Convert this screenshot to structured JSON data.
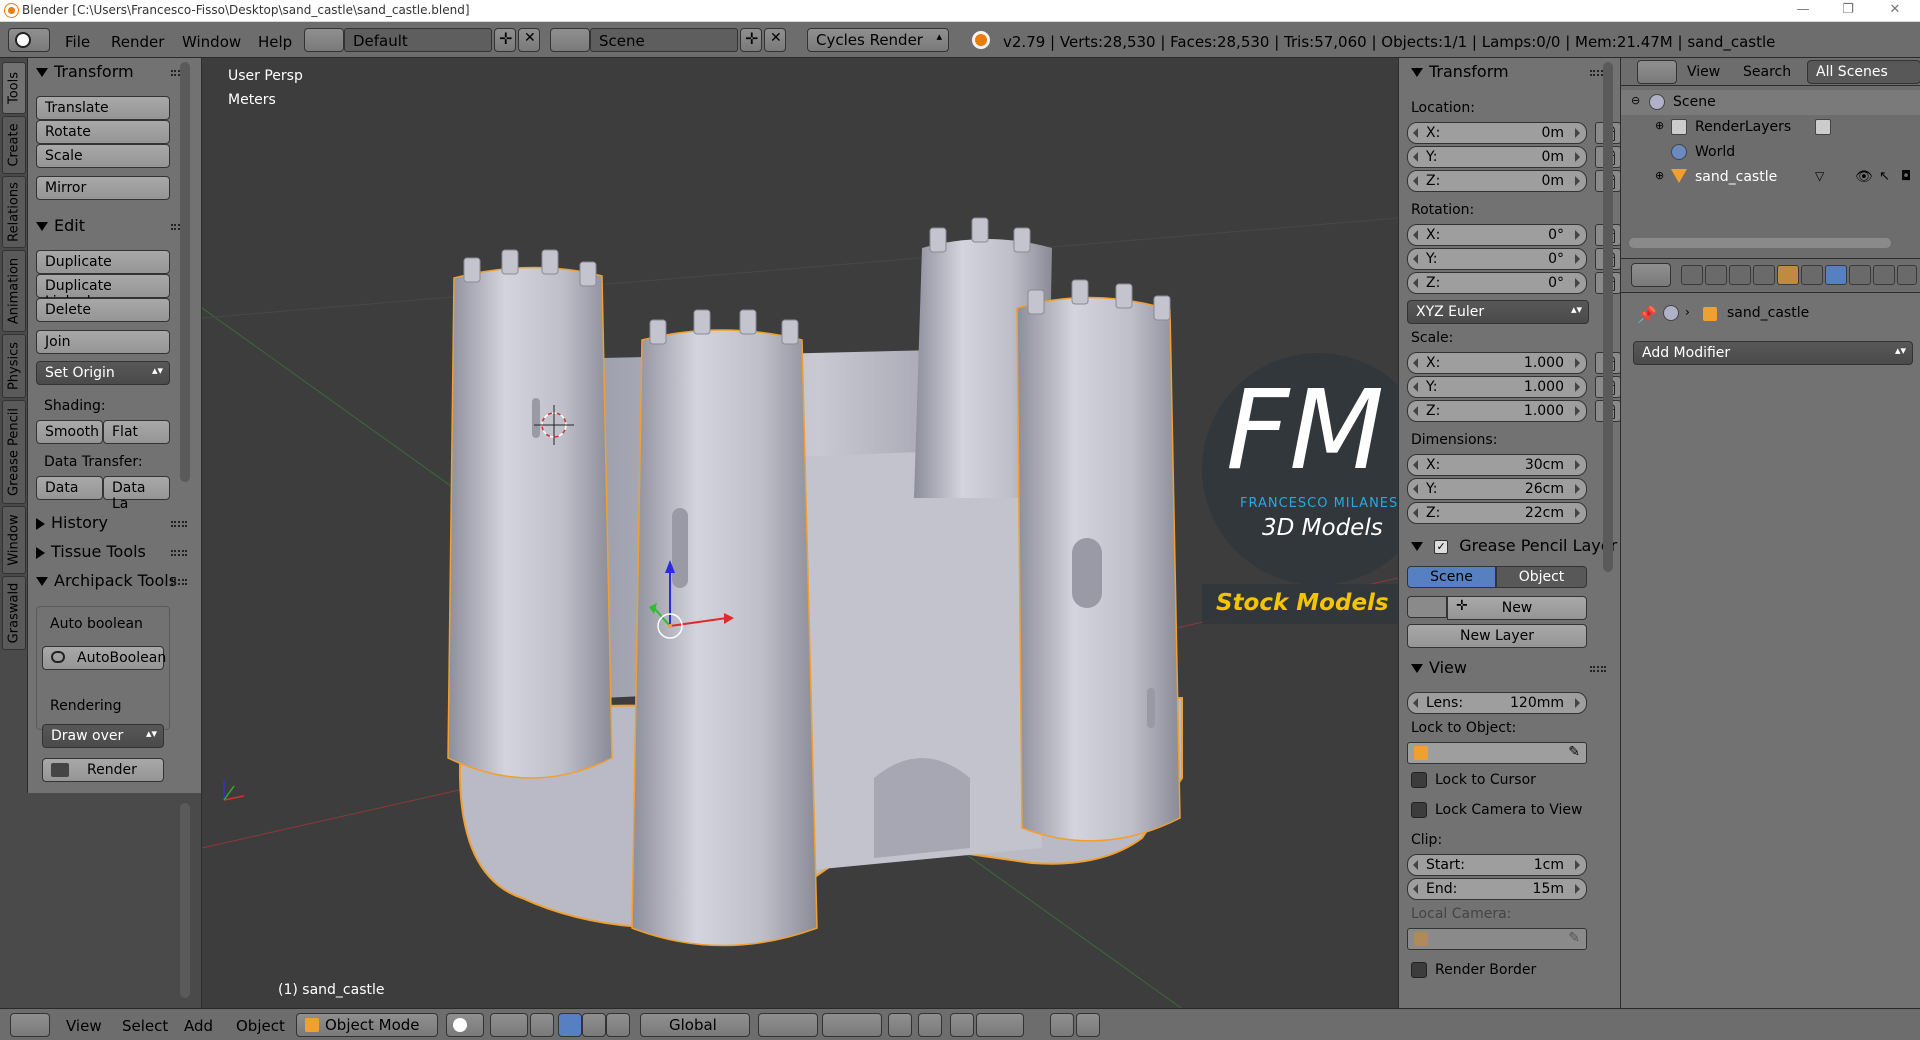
{
  "window": {
    "title": "Blender [C:\\Users\\Francesco-Fisso\\Desktop\\sand_castle\\sand_castle.blend]"
  },
  "info_header": {
    "menus": [
      "File",
      "Render",
      "Window",
      "Help"
    ],
    "screen_layout": "Default",
    "scene": "Scene",
    "render_engine": "Cycles Render",
    "stats": "v2.79 | Verts:28,530 | Faces:28,530 | Tris:57,060 | Objects:1/1 | Lamps:0/0 | Mem:21.47M | sand_castle"
  },
  "vertical_tabs": [
    "Tools",
    "Create",
    "Relations",
    "Animation",
    "Physics",
    "Grease Pencil",
    "Window",
    "Graswald"
  ],
  "tool_shelf": {
    "transform": {
      "title": "Transform",
      "buttons": [
        "Translate",
        "Rotate",
        "Scale",
        "Mirror"
      ]
    },
    "edit": {
      "title": "Edit",
      "buttons": [
        "Duplicate",
        "Duplicate Linked",
        "Delete",
        "Join"
      ],
      "set_origin": "Set Origin",
      "shading_label": "Shading:",
      "smooth": "Smooth",
      "flat": "Flat",
      "data_transfer_label": "Data Transfer:",
      "data": "Data",
      "data_la": "Data La"
    },
    "history": "History",
    "tissue_tools": "Tissue Tools",
    "archipack": {
      "title": "Archipack Tools",
      "auto_boolean_label": "Auto boolean",
      "auto_boolean_btn": "AutoBoolean",
      "rendering_label": "Rendering",
      "draw_over": "Draw over",
      "render_btn": "Render"
    }
  },
  "viewport": {
    "view_name": "User Persp",
    "units": "Meters",
    "object_label": "(1) sand_castle",
    "watermark": {
      "fm": "FM",
      "name": "FRANCESCO MILANESE",
      "models": "3D Models",
      "stock": "Stock Models"
    }
  },
  "n_panel": {
    "transform_title": "Transform",
    "location_label": "Location:",
    "location": [
      {
        "axis": "X:",
        "value": "0m"
      },
      {
        "axis": "Y:",
        "value": "0m"
      },
      {
        "axis": "Z:",
        "value": "0m"
      }
    ],
    "rotation_label": "Rotation:",
    "rotation": [
      {
        "axis": "X:",
        "value": "0°"
      },
      {
        "axis": "Y:",
        "value": "0°"
      },
      {
        "axis": "Z:",
        "value": "0°"
      }
    ],
    "rotation_mode": "XYZ Euler",
    "scale_label": "Scale:",
    "scale": [
      {
        "axis": "X:",
        "value": "1.000"
      },
      {
        "axis": "Y:",
        "value": "1.000"
      },
      {
        "axis": "Z:",
        "value": "1.000"
      }
    ],
    "dimensions_label": "Dimensions:",
    "dimensions": [
      {
        "axis": "X:",
        "value": "30cm"
      },
      {
        "axis": "Y:",
        "value": "26cm"
      },
      {
        "axis": "Z:",
        "value": "22cm"
      }
    ],
    "grease_pencil_title": "Grease Pencil Layer",
    "gp_scene": "Scene",
    "gp_object": "Object",
    "gp_new": "New",
    "gp_new_layer": "New Layer",
    "view_title": "View",
    "lens_label": "Lens:",
    "lens_value": "120mm",
    "lock_to_object_label": "Lock to Object:",
    "lock_to_cursor": "Lock to Cursor",
    "lock_camera_to_view": "Lock Camera to View",
    "clip_label": "Clip:",
    "clip_start_label": "Start:",
    "clip_start_value": "1cm",
    "clip_end_label": "End:",
    "clip_end_value": "15m",
    "local_camera_label": "Local Camera:",
    "render_border": "Render Border"
  },
  "outliner": {
    "view": "View",
    "search": "Search",
    "filter": "All Scenes",
    "items": [
      {
        "label": "Scene"
      },
      {
        "label": "RenderLayers"
      },
      {
        "label": "World"
      },
      {
        "label": "sand_castle"
      }
    ]
  },
  "properties": {
    "object_name": "sand_castle",
    "add_modifier": "Add Modifier"
  },
  "bottom_header": {
    "menus": [
      "View",
      "Select",
      "Add",
      "Object"
    ],
    "mode": "Object Mode",
    "orientation": "Global"
  },
  "colors": {
    "accent_blue": "#5680c2",
    "fm_blue": "#29a8e0",
    "stock_yellow": "#f5c400",
    "object_outline": "#f0a030"
  }
}
